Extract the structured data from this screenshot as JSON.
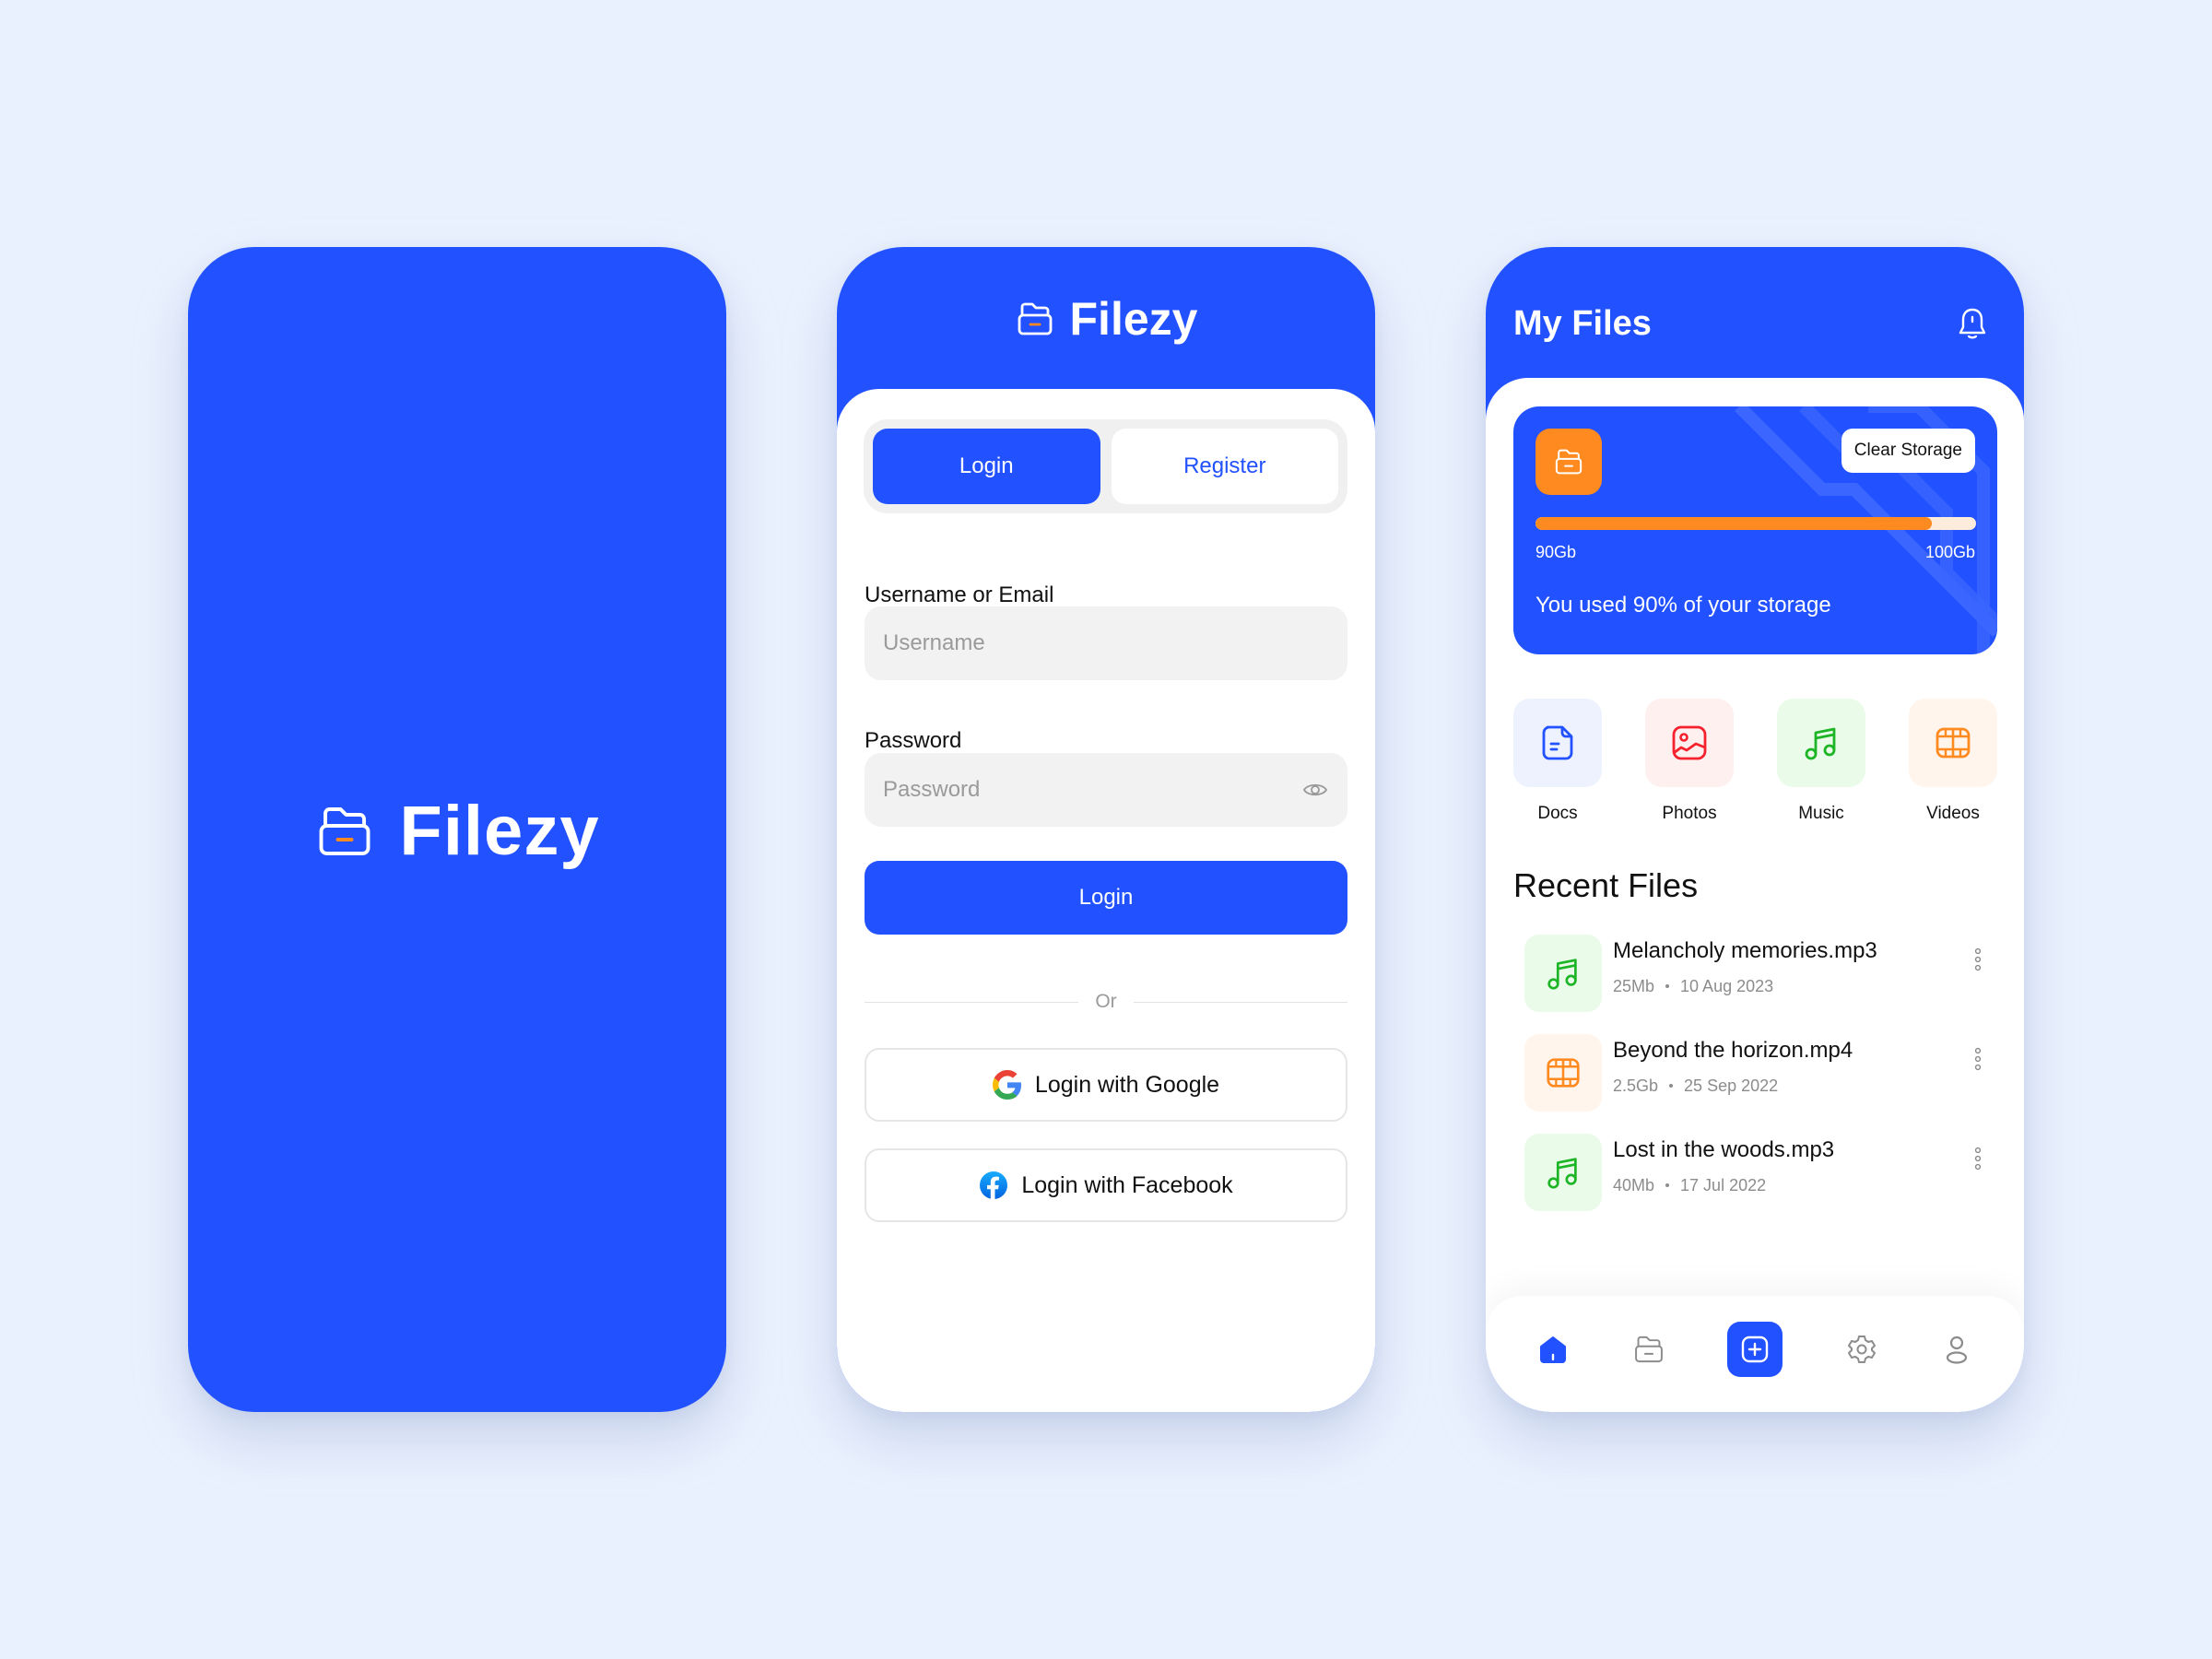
{
  "brand": {
    "name": "Filezy",
    "primary_color": "#2251FF",
    "accent_color": "#FF8A1F",
    "background_color": "#EAF1FE",
    "logo_icon": "folder-drawer-icon"
  },
  "splash": {
    "brand_name": "Filezy"
  },
  "login": {
    "header_brand": "Filezy",
    "tabs": [
      {
        "label": "Login",
        "active": true
      },
      {
        "label": "Register",
        "active": false
      }
    ],
    "username": {
      "label": "Username or Email",
      "placeholder": "Username",
      "value": ""
    },
    "password": {
      "label": "Password",
      "placeholder": "Password",
      "value": "",
      "toggle_icon": "eye-icon"
    },
    "submit_label": "Login",
    "divider_text": "Or",
    "social": [
      {
        "label": "Login with Google",
        "icon": "google-icon"
      },
      {
        "label": "Login with Facebook",
        "icon": "facebook-icon"
      }
    ]
  },
  "files": {
    "title": "My Files",
    "notification_icon": "bell-icon",
    "storage": {
      "clear_label": "Clear Storage",
      "used_label": "90Gb",
      "total_label": "100Gb",
      "used_fraction": 0.9,
      "summary": "You used 90% of your storage"
    },
    "categories": [
      {
        "label": "Docs",
        "icon": "document-icon",
        "color": "#2251FF",
        "bg": "#EEF2FF"
      },
      {
        "label": "Photos",
        "icon": "image-icon",
        "color": "#F5222D",
        "bg": "#FFF0F0"
      },
      {
        "label": "Music",
        "icon": "music-note-icon",
        "color": "#1DB526",
        "bg": "#EAFBEA"
      },
      {
        "label": "Videos",
        "icon": "film-icon",
        "color": "#FF8A1F",
        "bg": "#FFF5EC"
      }
    ],
    "recent_title": "Recent Files",
    "recent_files": [
      {
        "name": "Melancholy memories.mp3",
        "size": "25Mb",
        "date": "10 Aug 2023",
        "type": "music"
      },
      {
        "name": "Beyond the horizon.mp4",
        "size": "2.5Gb",
        "date": "25 Sep 2022",
        "type": "video"
      },
      {
        "name": "Lost in the woods.mp3",
        "size": "40Mb",
        "date": "17 Jul 2022",
        "type": "music"
      }
    ],
    "bottom_nav": [
      {
        "name": "home",
        "icon": "home-icon",
        "active": true
      },
      {
        "name": "files",
        "icon": "folder-icon",
        "active": false
      },
      {
        "name": "add",
        "icon": "plus-square-icon",
        "active": false
      },
      {
        "name": "settings",
        "icon": "gear-icon",
        "active": false
      },
      {
        "name": "profile",
        "icon": "user-icon",
        "active": false
      }
    ]
  }
}
